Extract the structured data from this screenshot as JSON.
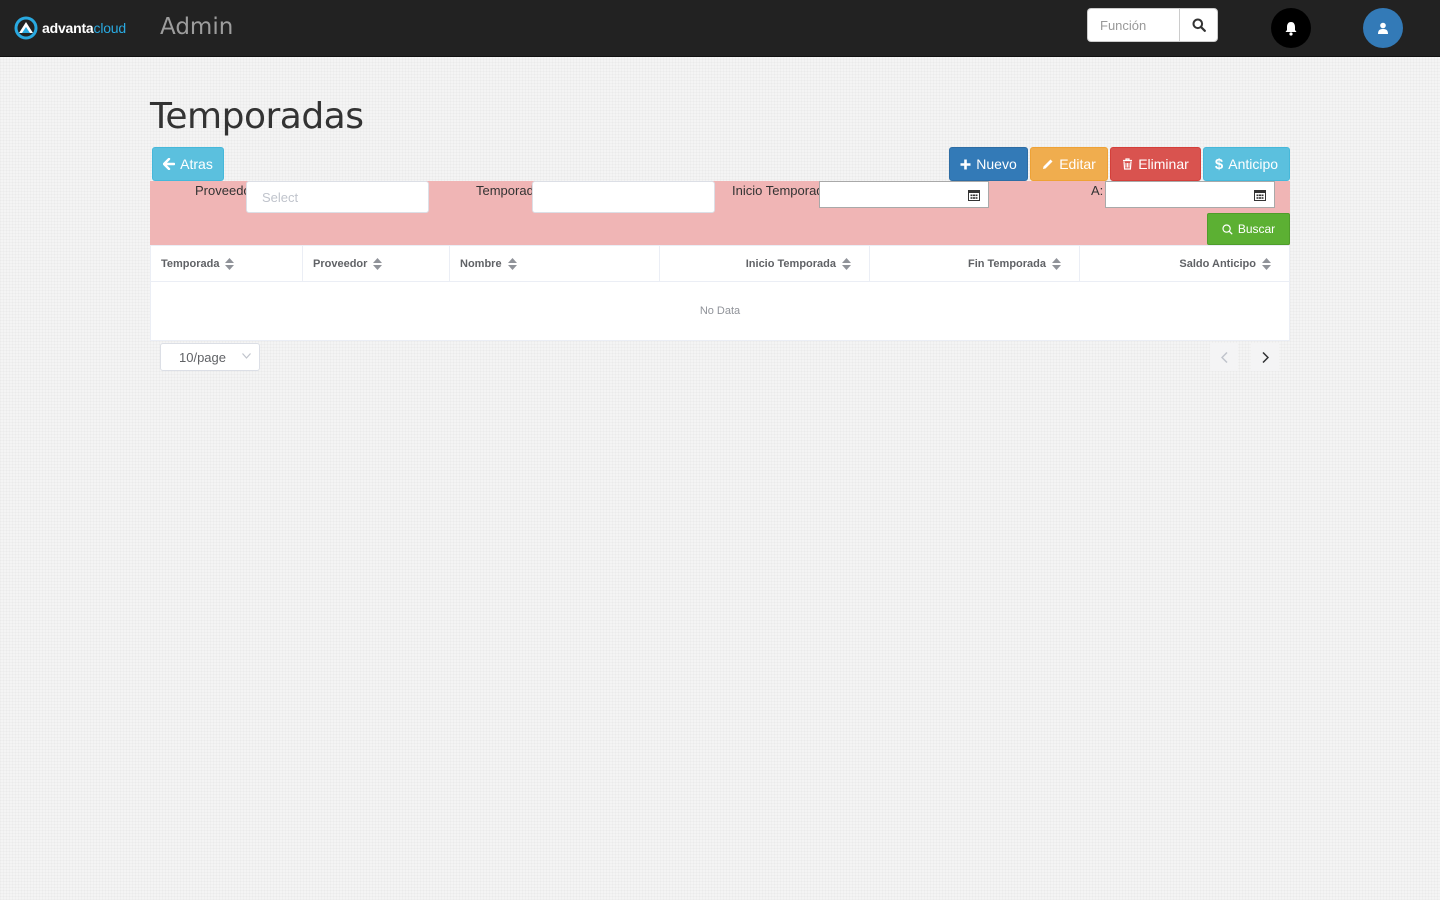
{
  "navbar": {
    "brand_part1": "advanta",
    "brand_part2": "cloud",
    "title": "Admin",
    "search_placeholder": "Función"
  },
  "page": {
    "title": "Temporadas"
  },
  "toolbar": {
    "atras": "Atras",
    "nuevo": "Nuevo",
    "editar": "Editar",
    "eliminar": "Eliminar",
    "anticipo": "Anticipo"
  },
  "filters": {
    "proveedor_label": "Proveedor",
    "proveedor_placeholder": "Select",
    "temporada_label": "Temporada",
    "inicio_label": "Inicio Temporada:",
    "a_label": "A:",
    "buscar": "Buscar"
  },
  "table": {
    "columns": [
      "Temporada",
      "Proveedor",
      "Nombre",
      "Inicio Temporada",
      "Fin Temporada",
      "Saldo Anticipo"
    ],
    "empty_text": "No Data"
  },
  "pagination": {
    "page_size": "10/page"
  },
  "colors": {
    "navbar": "#222222",
    "primary": "#337ab7",
    "info": "#5bc0de",
    "warning": "#f0ad4e",
    "danger": "#d9534f",
    "success": "#5cb033",
    "filter_panel": "#f0b5b5"
  }
}
